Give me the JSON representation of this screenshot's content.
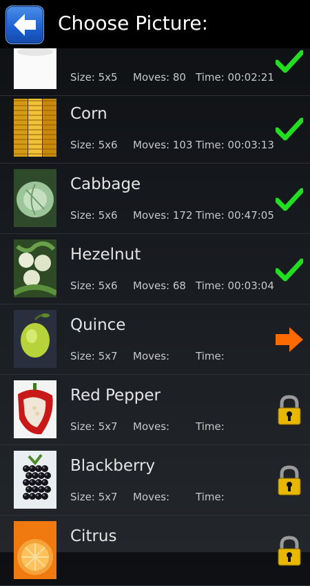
{
  "header": {
    "title": "Choose Picture:"
  },
  "pictures": [
    {
      "name": "",
      "size": "Size: 5x5",
      "moves": "Moves: 80",
      "time": "Time: 00:02:21",
      "status": "completed",
      "thumb": "broccoli"
    },
    {
      "name": "Corn",
      "size": "Size: 5x6",
      "moves": "Moves: 103",
      "time": "Time: 00:03:13",
      "status": "completed",
      "thumb": "corn"
    },
    {
      "name": "Cabbage",
      "size": "Size: 5x6",
      "moves": "Moves: 172",
      "time": "Time: 00:47:05",
      "status": "completed",
      "thumb": "cabbage"
    },
    {
      "name": "Hezelnut",
      "size": "Size: 5x6",
      "moves": "Moves: 68",
      "time": "Time: 00:03:04",
      "status": "completed",
      "thumb": "hazelnut"
    },
    {
      "name": "Quince",
      "size": "Size: 5x7",
      "moves": "Moves:",
      "time": "Time:",
      "status": "current",
      "thumb": "quince"
    },
    {
      "name": "Red Pepper",
      "size": "Size: 5x7",
      "moves": "Moves:",
      "time": "Time:",
      "status": "locked",
      "thumb": "pepper"
    },
    {
      "name": "Blackberry",
      "size": "Size: 5x7",
      "moves": "Moves:",
      "time": "Time:",
      "status": "locked",
      "thumb": "blackberry"
    },
    {
      "name": "Citrus",
      "size": "",
      "moves": "",
      "time": "",
      "status": "locked",
      "thumb": "citrus"
    }
  ],
  "colors": {
    "check": "#22dd22",
    "arrow": "#ff6a00",
    "lock": "#e8b800",
    "back_button": "#1d5fd0"
  },
  "icons": {
    "back": "back-arrow-icon",
    "completed": "checkmark-icon",
    "current": "play-arrow-icon",
    "locked": "padlock-icon"
  }
}
